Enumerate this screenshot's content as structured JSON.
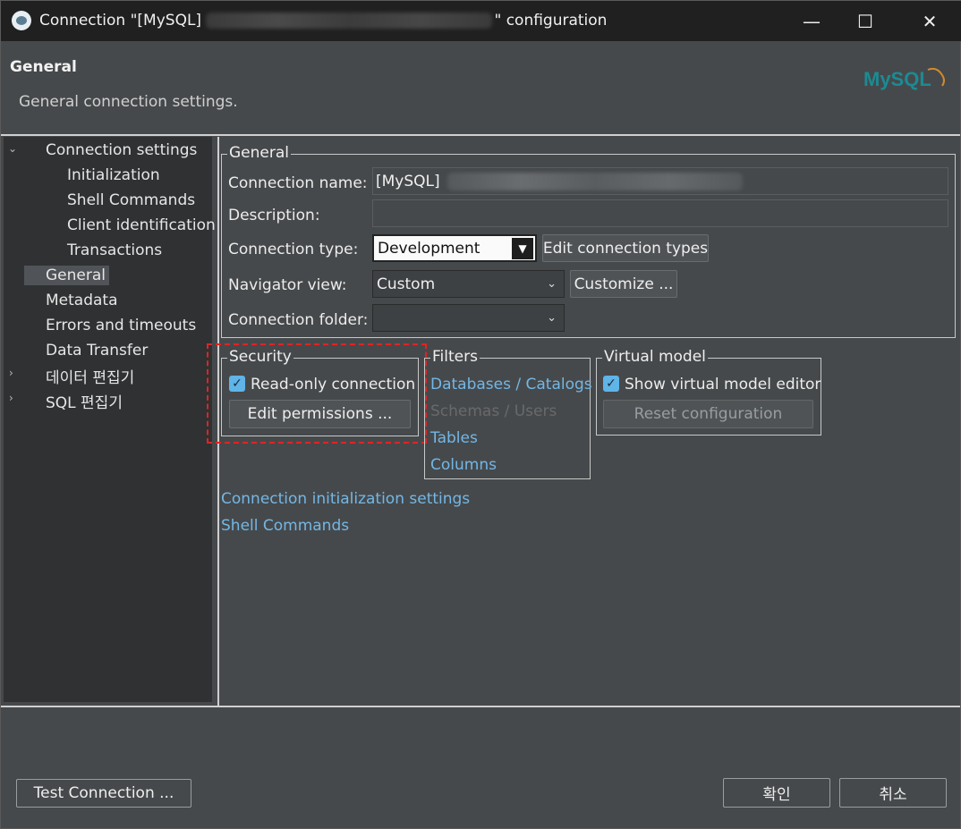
{
  "window": {
    "title_prefix": "Connection \"[MySQL]",
    "title_suffix": "\" configuration",
    "minimize": "—",
    "maximize": "☐",
    "close": "✕"
  },
  "header": {
    "title": "General",
    "description": "General connection settings.",
    "logo_text": "MySQL"
  },
  "tree": {
    "items": [
      {
        "label": "Connection settings"
      },
      {
        "label": "Initialization"
      },
      {
        "label": "Shell Commands"
      },
      {
        "label": "Client identification"
      },
      {
        "label": "Transactions"
      },
      {
        "label": "General"
      },
      {
        "label": "Metadata"
      },
      {
        "label": "Errors and timeouts"
      },
      {
        "label": "Data Transfer"
      },
      {
        "label": "데이터 편집기"
      },
      {
        "label": "SQL 편집기"
      }
    ]
  },
  "general": {
    "legend": "General",
    "connection_name_label": "Connection name:",
    "connection_name_value": "[MySQL]",
    "description_label": "Description:",
    "description_value": "",
    "connection_type_label": "Connection type:",
    "connection_type_value": "Development",
    "edit_types_button": "Edit connection types",
    "navigator_view_label": "Navigator view:",
    "navigator_view_value": "Custom",
    "customize_button": "Customize ...",
    "connection_folder_label": "Connection folder:",
    "connection_folder_value": ""
  },
  "security": {
    "legend": "Security",
    "readonly_label": "Read-only connection",
    "readonly_checked": true,
    "edit_permissions_button": "Edit permissions ..."
  },
  "filters": {
    "legend": "Filters",
    "links": [
      {
        "label": "Databases / Catalogs",
        "enabled": true
      },
      {
        "label": "Schemas / Users",
        "enabled": false
      },
      {
        "label": "Tables",
        "enabled": true
      },
      {
        "label": "Columns",
        "enabled": true
      }
    ]
  },
  "virtual_model": {
    "legend": "Virtual model",
    "show_editor_label": "Show virtual model editor",
    "show_editor_checked": true,
    "reset_button": "Reset configuration"
  },
  "links": {
    "init_settings": "Connection initialization settings",
    "shell_commands": "Shell Commands"
  },
  "footer": {
    "test_connection": "Test Connection ...",
    "ok": "확인",
    "cancel": "취소"
  },
  "colors": {
    "accent_link": "#73b7e6",
    "checkbox": "#5fb4e8",
    "highlight_box": "#e02424"
  }
}
